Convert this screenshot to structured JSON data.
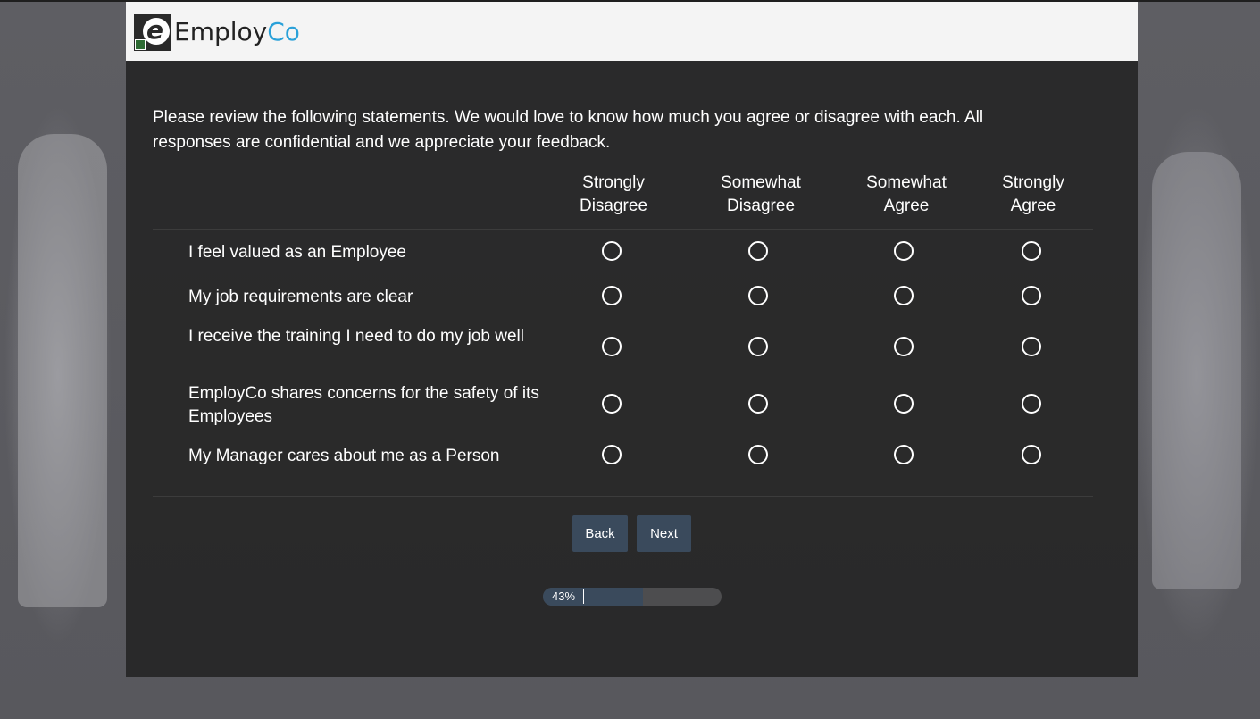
{
  "header": {
    "brand_main": "Employ",
    "brand_accent": "Co",
    "logo_icon": "employco-logo-icon",
    "accent_color": "#2aa1d9"
  },
  "survey": {
    "intro": "Please review the following statements. We would love to know how much you agree or disagree with each.  All responses are confidential and we appreciate your feedback.",
    "columns": [
      {
        "line1": "Strongly",
        "line2": "Disagree"
      },
      {
        "line1": "Somewhat",
        "line2": "Disagree"
      },
      {
        "line1": "Somewhat",
        "line2": "Agree"
      },
      {
        "line1": "Strongly",
        "line2": "Agree"
      }
    ],
    "statements": [
      "I feel valued as an Employee",
      "My job requirements are clear",
      "I receive the training I need to do my job well",
      "EmployCo shares concerns for the safety of its Employees",
      "My Manager cares about me as a Person"
    ]
  },
  "navigation": {
    "back_label": "Back",
    "next_label": "Next"
  },
  "progress": {
    "percent": 43,
    "label": "43%",
    "fill_color": "#3a4a5c"
  }
}
